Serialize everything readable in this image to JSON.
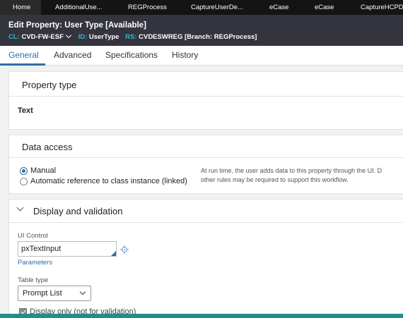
{
  "top_tabs": [
    "Home",
    "AdditionalUse...",
    "REGProcess",
    "CaptureUserDe...",
    "eCase",
    "eCase",
    "CaptureHCPDe..."
  ],
  "header": {
    "title": "Edit  Property: User Type [Available]",
    "cl_label": "CL:",
    "cl_value": "CVD-FW-ESF",
    "id_label": "ID:",
    "id_value": "UserType",
    "rs_label": "RS:",
    "rs_value": "CVDESWREG [Branch: REGProcess]"
  },
  "rule_tabs": [
    "General",
    "Advanced",
    "Specifications",
    "History"
  ],
  "property_type": {
    "title": "Property type",
    "value": "Text"
  },
  "data_access": {
    "title": "Data access",
    "option_manual": "Manual",
    "option_auto": "Automatic reference to class instance (linked)",
    "help_line1": "At run time, the user adds data to this property through the UI. D",
    "help_line2": "other rules may be required to support this workflow."
  },
  "display_validation": {
    "title": "Display and validation",
    "ui_control_label": "UI Control",
    "ui_control_value": "pxTextInput",
    "parameters_link": "Parameters",
    "table_type_label": "Table type",
    "table_type_value": "Prompt List",
    "display_only_label": "Display only (not for validation)"
  },
  "colors": {
    "tab_bar": "#141414",
    "header_bg": "#33343e",
    "accent": "#2e6ea6",
    "meta_key": "#37b6c4"
  }
}
